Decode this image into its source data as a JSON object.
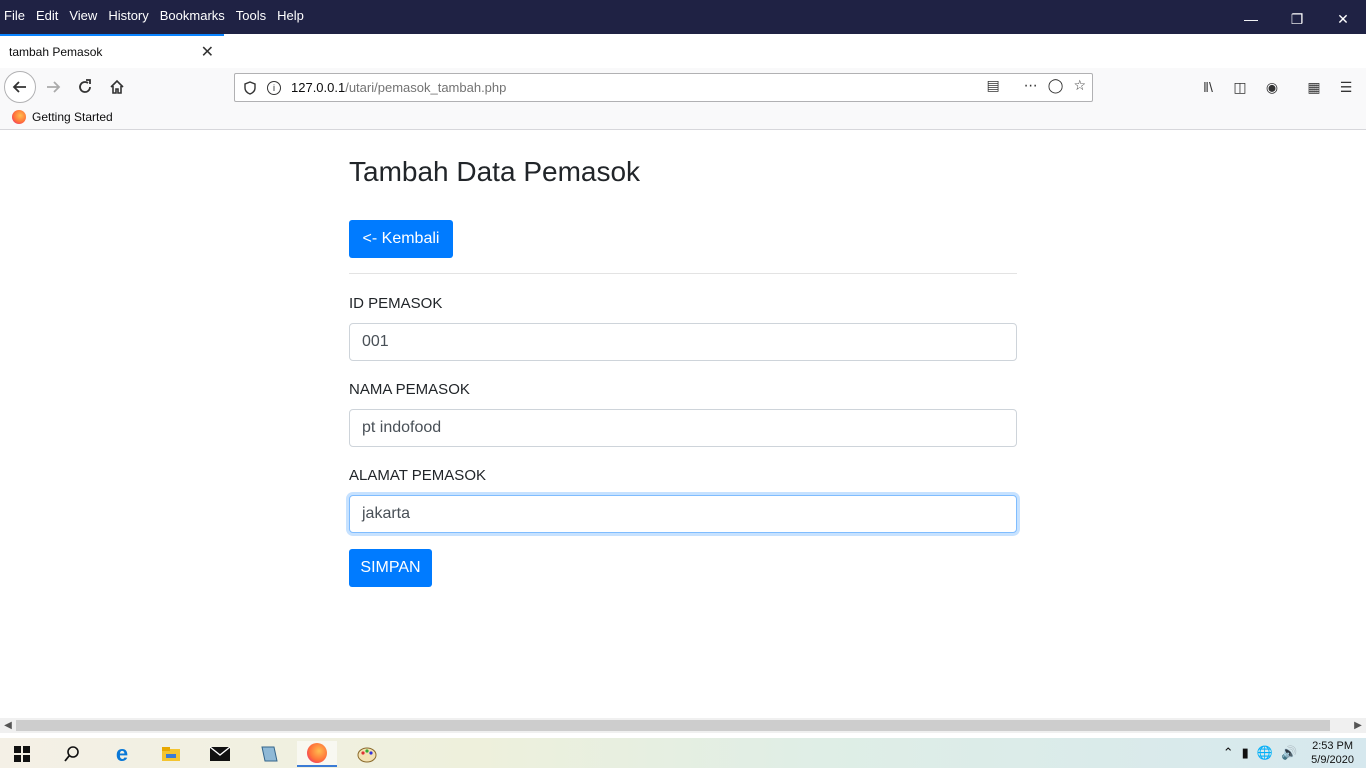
{
  "menu": [
    "File",
    "Edit",
    "View",
    "History",
    "Bookmarks",
    "Tools",
    "Help"
  ],
  "tab": {
    "title": "tambah Pemasok",
    "close": "✕",
    "new_tab": "+"
  },
  "url": {
    "host": "127.0.0.1",
    "path": "/utari/pemasok_tambah.php"
  },
  "bookmarks": {
    "item": "Getting Started"
  },
  "page": {
    "title": "Tambah Data Pemasok",
    "back_label": "<- Kembali",
    "fields": [
      {
        "label": "ID PEMASOK",
        "value": "001"
      },
      {
        "label": "NAMA PEMASOK",
        "value": "pt indofood"
      },
      {
        "label": "ALAMAT PEMASOK",
        "value": "jakarta"
      }
    ],
    "save_label": "SIMPAN"
  },
  "taskbar": {
    "time": "2:53 PM",
    "date": "5/9/2020"
  },
  "colors": {
    "primary": "#007bff",
    "titlebar": "#1f2244"
  }
}
